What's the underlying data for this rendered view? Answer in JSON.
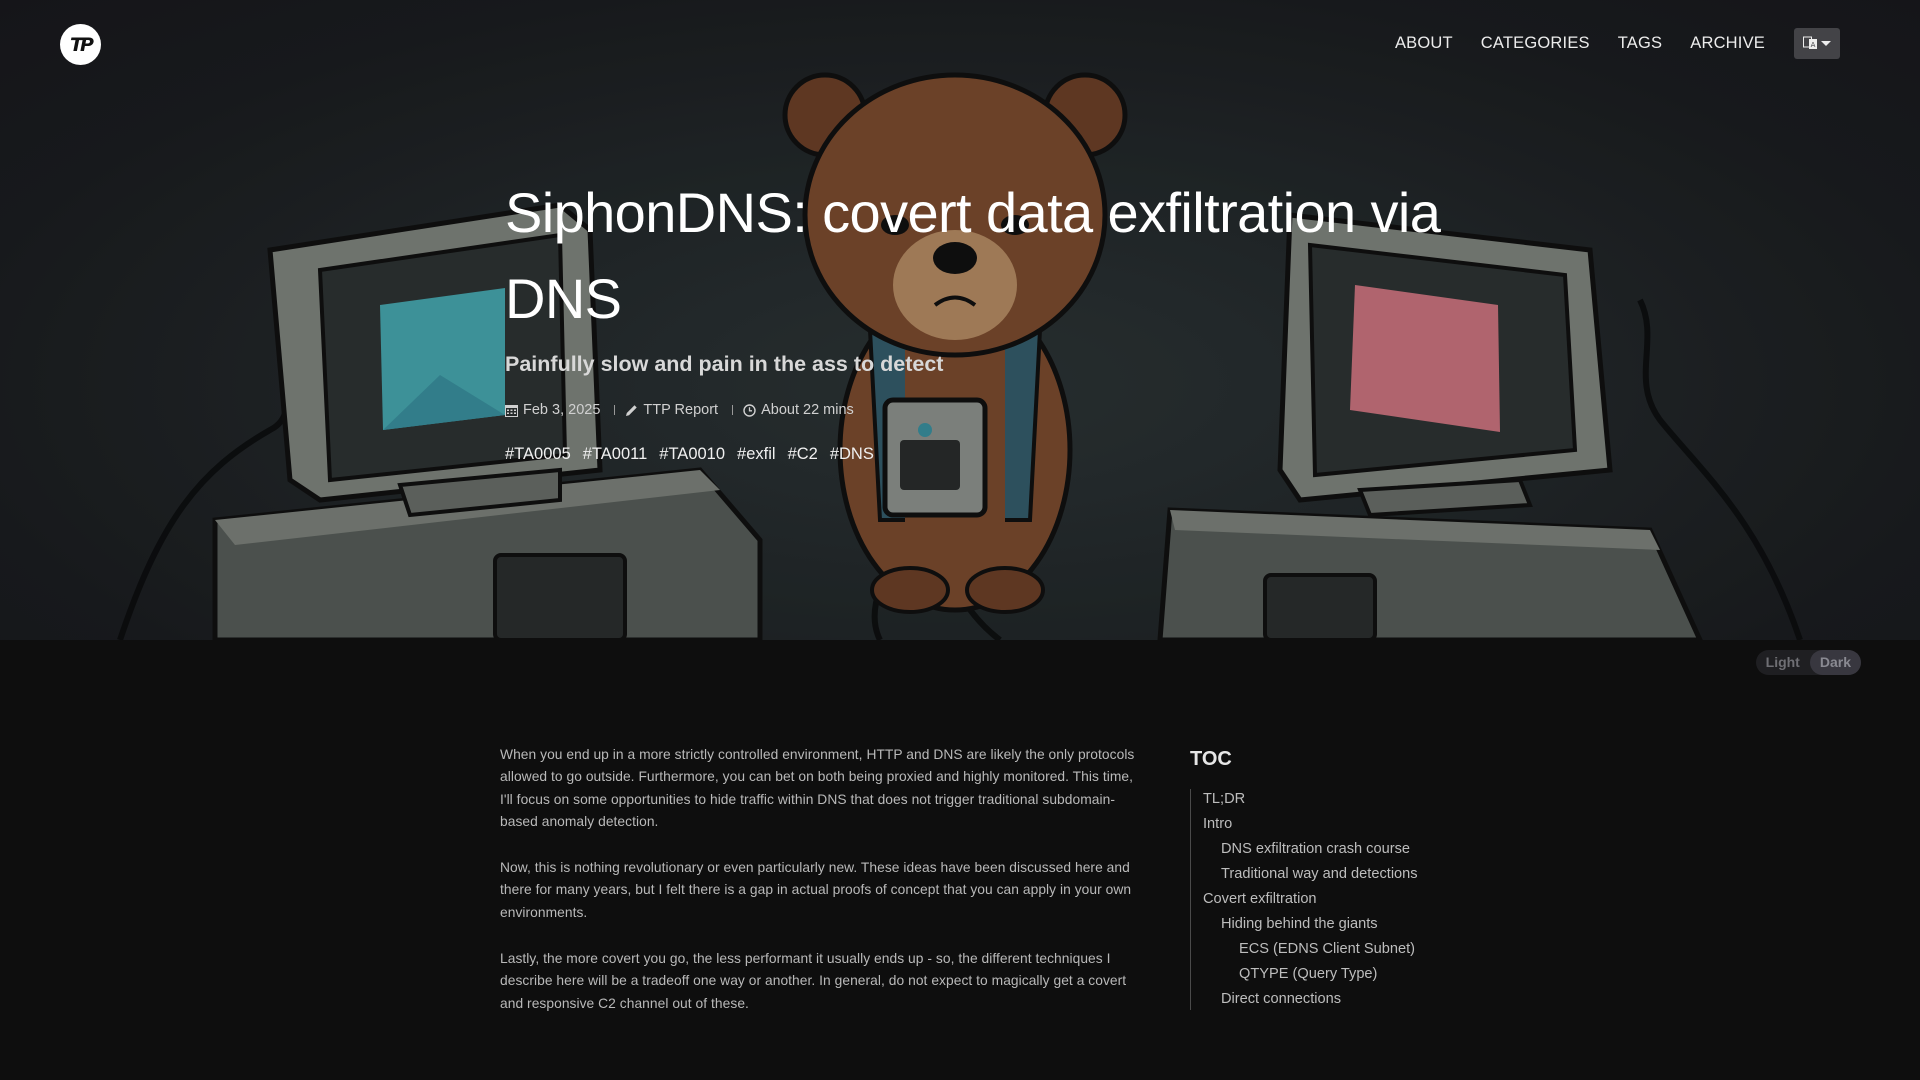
{
  "navbar": {
    "logo_text": "TP",
    "links": [
      {
        "label": "ABOUT"
      },
      {
        "label": "CATEGORIES"
      },
      {
        "label": "TAGS"
      },
      {
        "label": "ARCHIVE"
      }
    ],
    "language_icon": "translate-icon"
  },
  "hero": {
    "title": "SiphonDNS: covert data exfiltration via DNS",
    "subtitle": "Painfully slow and pain in the ass to detect",
    "meta": {
      "date": "Feb 3, 2025",
      "category": "TTP Report",
      "reading_time": "About 22 mins"
    },
    "tags": [
      "#TA0005",
      "#TA0011",
      "#TA0010",
      "#exfil",
      "#C2",
      "#DNS"
    ],
    "colors": {
      "left_screen": "#46a6ad",
      "right_screen": "#c9727e",
      "bear": "#7a4a2e"
    }
  },
  "theme_switch": {
    "options": [
      "Light",
      "Dark"
    ],
    "active": "Dark"
  },
  "article": {
    "paragraphs": [
      "When you end up in a more strictly controlled environment, HTTP and DNS are likely the only protocols allowed to go outside. Furthermore, you can bet on both being proxied and highly monitored. This time, I'll focus on some opportunities to hide traffic within DNS that does not trigger traditional subdomain-based anomaly detection.",
      "Now, this is nothing revolutionary or even particularly new. These ideas have been discussed here and there for many years, but I felt there is a gap in actual proofs of concept that you can apply in your own environments.",
      "Lastly, the more covert you go, the less performant it usually ends up - so, the different techniques I describe here will be a tradeoff one way or another. In general, do not expect to magically get a covert and responsive C2 channel out of these."
    ]
  },
  "toc": {
    "title": "TOC",
    "items": [
      {
        "label": "TL;DR",
        "level": 1
      },
      {
        "label": "Intro",
        "level": 1
      },
      {
        "label": "DNS exfiltration crash course",
        "level": 2
      },
      {
        "label": "Traditional way and detections",
        "level": 2
      },
      {
        "label": "Covert exfiltration",
        "level": 1
      },
      {
        "label": "Hiding behind the giants",
        "level": 2
      },
      {
        "label": "ECS (EDNS Client Subnet)",
        "level": 3
      },
      {
        "label": "QTYPE (Query Type)",
        "level": 3
      },
      {
        "label": "Direct connections",
        "level": 2
      }
    ]
  }
}
